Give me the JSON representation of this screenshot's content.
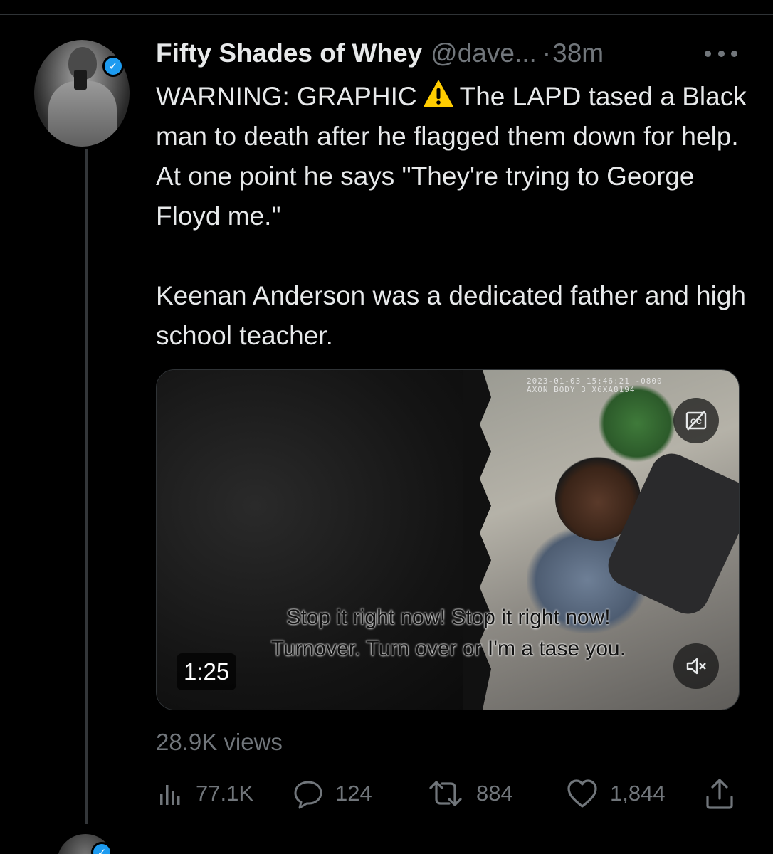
{
  "tweet": {
    "display_name": "Fifty Shades of Whey",
    "handle": "@dave...",
    "separator": "·",
    "time": "38m",
    "text_line1_a": "WARNING: GRAPHIC",
    "text_line1_b": "The LAPD tased a Black man to death after he flagged them down for help. At one point he says \"They're trying to George Floyd me.\"",
    "text_para2": "Keenan Anderson was a dedicated father and high school teacher.",
    "views": "28.9K views"
  },
  "video": {
    "timestamp_line1": "2023-01-03 15:46:21 -0800",
    "timestamp_line2": "AXON BODY 3 X6XA8194",
    "subtitle_line1": "Stop it right now! Stop it right now!",
    "subtitle_line2": "Turnover. Turn over or I'm a tase you.",
    "duration": "1:25",
    "icons": {
      "captions": "closed-captions-icon",
      "mute": "muted-speaker-icon"
    }
  },
  "actions": {
    "analytics": "77.1K",
    "replies": "124",
    "retweets": "884",
    "likes": "1,844"
  },
  "colors": {
    "background": "#000000",
    "text": "#e7e9ea",
    "muted": "#71767b",
    "verified": "#1d9bf0",
    "warning": "#ffcc00"
  }
}
